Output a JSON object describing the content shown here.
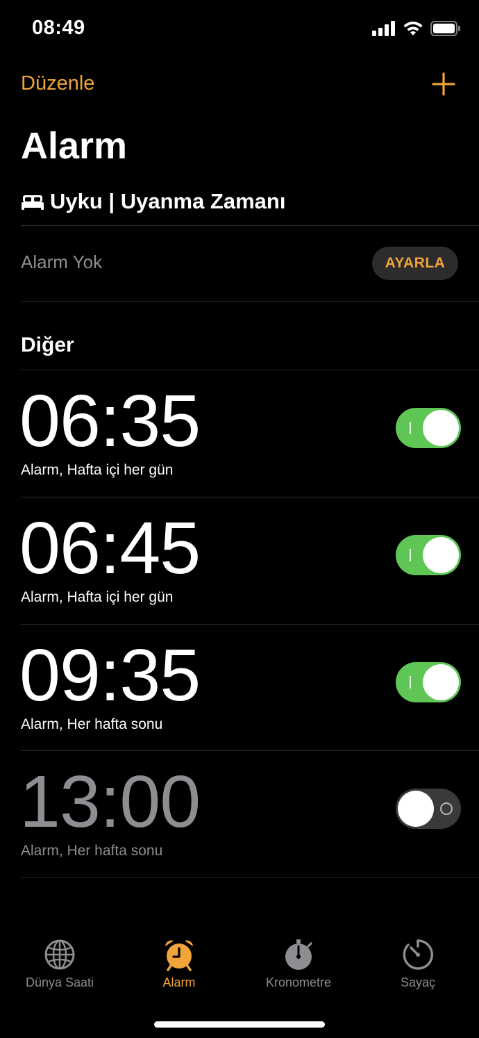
{
  "status_bar": {
    "time": "08:49"
  },
  "nav": {
    "edit_label": "Düzenle",
    "add_icon": "plus-icon"
  },
  "title": "Alarm",
  "sleep": {
    "icon": "bed-icon",
    "header": "Uyku | Uyanma Zamanı",
    "no_alarm_text": "Alarm Yok",
    "set_button_label": "AYARLA"
  },
  "other_section_title": "Diğer",
  "alarms": [
    {
      "time": "06:35",
      "label": "Alarm, Hafta içi her gün",
      "enabled": true
    },
    {
      "time": "06:45",
      "label": "Alarm, Hafta içi her gün",
      "enabled": true
    },
    {
      "time": "09:35",
      "label": "Alarm, Her hafta sonu",
      "enabled": true
    },
    {
      "time": "13:00",
      "label": "Alarm, Her hafta sonu",
      "enabled": false
    }
  ],
  "tabs": [
    {
      "label": "Dünya Saati",
      "icon": "globe-icon",
      "active": false
    },
    {
      "label": "Alarm",
      "icon": "alarm-clock-icon",
      "active": true
    },
    {
      "label": "Kronometre",
      "icon": "stopwatch-icon",
      "active": false
    },
    {
      "label": "Sayaç",
      "icon": "timer-icon",
      "active": false
    }
  ],
  "colors": {
    "accent": "#f0a43a",
    "toggle_on": "#5fc656",
    "toggle_off": "#3a3a3c",
    "secondary_text": "#8d8d92"
  }
}
